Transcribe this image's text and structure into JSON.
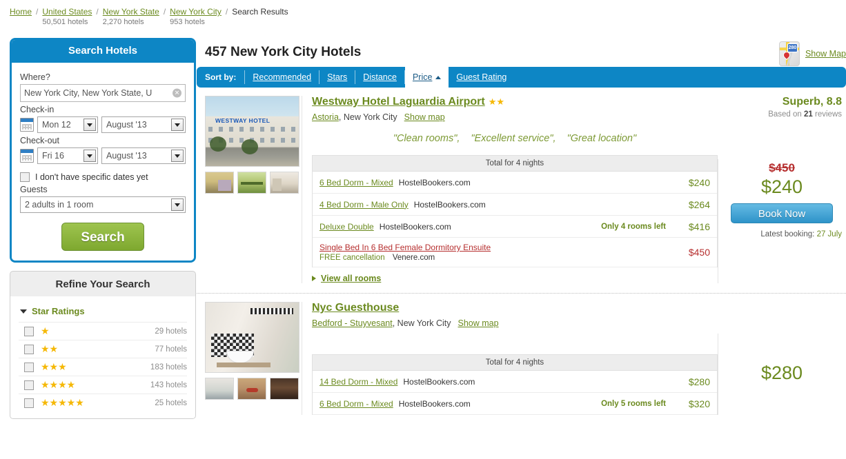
{
  "breadcrumb": [
    {
      "label": "Home",
      "sub": "",
      "link": true
    },
    {
      "label": "United States",
      "sub": "50,501 hotels",
      "link": true
    },
    {
      "label": "New York State",
      "sub": "2,270 hotels",
      "link": true
    },
    {
      "label": "New York City",
      "sub": "953 hotels",
      "link": true
    },
    {
      "label": "Search Results",
      "sub": "",
      "link": false
    }
  ],
  "search_panel": {
    "title": "Search Hotels",
    "where_label": "Where?",
    "where_value": "New York City, New York State, U",
    "clear_icon": "clear-icon",
    "checkin_label": "Check-in",
    "checkin_day": "Mon 12",
    "checkin_month": "August '13",
    "checkout_label": "Check-out",
    "checkout_day": "Fri 16",
    "checkout_month": "August '13",
    "no_dates_label": "I don't have specific dates yet",
    "guests_label": "Guests",
    "guests_value": "2 adults in 1 room",
    "search_button": "Search"
  },
  "refine_panel": {
    "title": "Refine Your Search",
    "group_label": "Star Ratings",
    "star_rows": [
      {
        "stars": "★",
        "count": "29 hotels"
      },
      {
        "stars": "★★",
        "count": "77 hotels"
      },
      {
        "stars": "★★★",
        "count": "183 hotels"
      },
      {
        "stars": "★★★★",
        "count": "143 hotels"
      },
      {
        "stars": "★★★★★",
        "count": "25 hotels"
      }
    ]
  },
  "header": {
    "results_title": "457 New York City Hotels",
    "show_map": "Show Map",
    "map_icon": "map-icon",
    "map_shield_number": "280"
  },
  "sortbar": {
    "label": "Sort by:",
    "items": [
      {
        "label": "Recommended",
        "active": false
      },
      {
        "label": "Stars",
        "active": false
      },
      {
        "label": "Distance",
        "active": false
      },
      {
        "label": "Price",
        "active": true,
        "sort_direction": "asc"
      },
      {
        "label": "Guest Rating",
        "active": false
      }
    ]
  },
  "hotels": [
    {
      "name": "Westway Hotel Laguardia Airport",
      "stars": "★★",
      "neighborhood": "Astoria",
      "city": "New York City",
      "show_map": "Show map",
      "quotes": [
        "\"Clean rooms\",",
        "\"Excellent service\",",
        "\"Great location\""
      ],
      "rating_text": "Superb, 8.8",
      "reviews_prefix": "Based on",
      "reviews_count": "21",
      "reviews_suffix": "reviews",
      "total_header": "Total for 4 nights",
      "rooms": [
        {
          "name": "6 Bed Dorm - Mixed",
          "provider": "HostelBookers.com",
          "left": "",
          "price": "$240",
          "red": false,
          "sub": ""
        },
        {
          "name": "4 Bed Dorm - Male Only",
          "provider": "HostelBookers.com",
          "left": "",
          "price": "$264",
          "red": false,
          "sub": ""
        },
        {
          "name": "Deluxe Double",
          "provider": "HostelBookers.com",
          "left": "Only 4 rooms left",
          "price": "$416",
          "red": false,
          "sub": ""
        },
        {
          "name": "Single Bed In 6 Bed Female Dormitory Ensuite",
          "provider": "",
          "left": "",
          "price": "$450",
          "red": true,
          "sub_free": "FREE cancellation",
          "sub_provider": "Venere.com"
        }
      ],
      "view_all": "View all rooms",
      "old_price": "$450",
      "new_price": "$240",
      "book_button": "Book Now",
      "latest_label": "Latest booking:",
      "latest_value": "27 July",
      "photos": {
        "main": "hotel-exterior-photo",
        "thumbs": [
          "room-thumb-1",
          "room-thumb-2",
          "room-thumb-3"
        ]
      }
    },
    {
      "name": "Nyc Guesthouse",
      "stars": "",
      "neighborhood": "Bedford - Stuyvesant",
      "city": "New York City",
      "show_map": "Show map",
      "quotes": [],
      "rating_text": "",
      "reviews_prefix": "",
      "reviews_count": "",
      "reviews_suffix": "",
      "total_header": "Total for 4 nights",
      "rooms": [
        {
          "name": "14 Bed Dorm - Mixed",
          "provider": "HostelBookers.com",
          "left": "",
          "price": "$280",
          "red": false,
          "sub": ""
        },
        {
          "name": "6 Bed Dorm - Mixed",
          "provider": "HostelBookers.com",
          "left": "Only 5 rooms left",
          "price": "$320",
          "red": false,
          "sub": ""
        }
      ],
      "view_all": "",
      "old_price": "",
      "new_price": "$280",
      "book_button": "",
      "latest_label": "",
      "latest_value": "",
      "photos": {
        "main": "bathroom-photo",
        "thumbs": [
          "room-thumb-1",
          "room-thumb-2",
          "room-thumb-3"
        ]
      }
    }
  ],
  "colors": {
    "brand_blue": "#0d86c5",
    "link_green": "#6b8a1f",
    "price_red": "#b62f2f",
    "star_gold": "#f5b806",
    "search_green": "#7ea82f"
  }
}
